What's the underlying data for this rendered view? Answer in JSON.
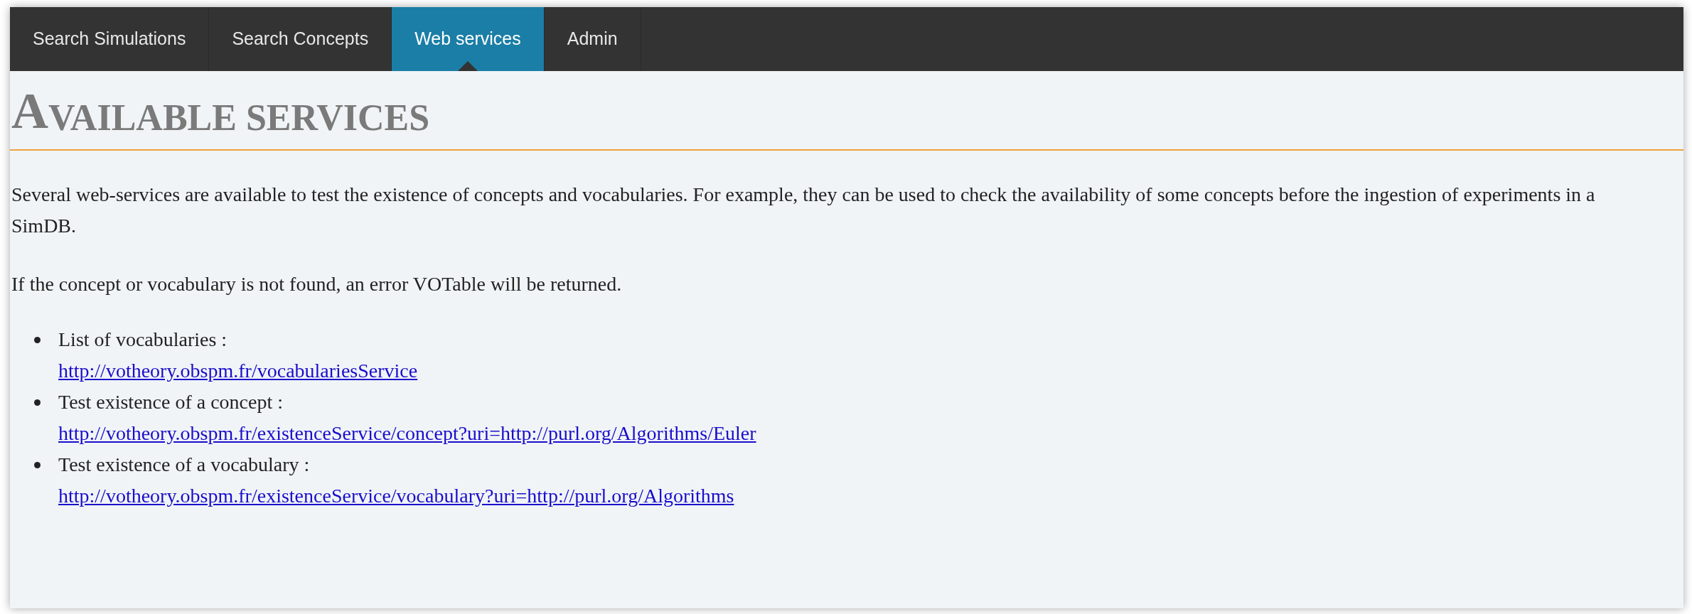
{
  "nav_tabs": [
    {
      "label": "Search Simulations",
      "selected": false
    },
    {
      "label": "Search Concepts",
      "selected": false
    },
    {
      "label": "Web services",
      "selected": true
    },
    {
      "label": "Admin",
      "selected": false
    }
  ],
  "heading": "AVAILABLE SERVICES",
  "paragraphs": [
    "Several web-services are available to test the existence of concepts and vocabularies. For example, they can be used to check the availability of some concepts before the ingestion of experiments in a SimDB.",
    "If the concept or vocabulary is not found, an error VOTable will be returned."
  ],
  "services": [
    {
      "label": "List of vocabularies :",
      "link": "http://votheory.obspm.fr/vocabulariesService"
    },
    {
      "label": "Test existence of a concept :",
      "link": "http://votheory.obspm.fr/existenceService/concept?uri=http://purl.org/Algorithms/Euler"
    },
    {
      "label": "Test existence of a vocabulary :",
      "link": "http://votheory.obspm.fr/existenceService/vocabulary?uri=http://purl.org/Algorithms"
    }
  ]
}
